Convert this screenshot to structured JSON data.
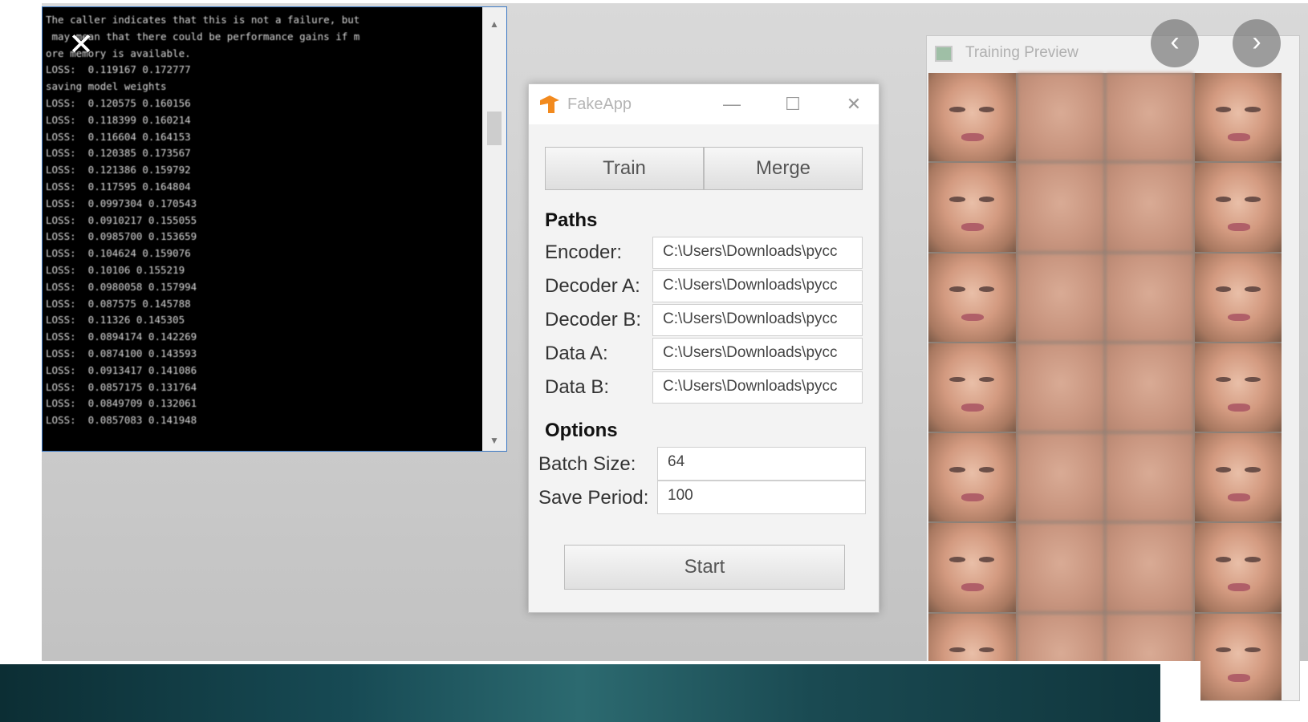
{
  "console": {
    "lines": [
      "The caller indicates that this is not a failure, but",
      " may mean that there could be performance gains if m",
      "ore memory is available.",
      "LOSS:  0.119167 0.172777",
      "saving model weights",
      "LOSS:  0.120575 0.160156",
      "LOSS:  0.118399 0.160214",
      "LOSS:  0.116604 0.164153",
      "LOSS:  0.120385 0.173567",
      "LOSS:  0.121386 0.159792",
      "LOSS:  0.117595 0.164804",
      "LOSS:  0.0997304 0.170543",
      "LOSS:  0.0910217 0.155055",
      "LOSS:  0.0985700 0.153659",
      "LOSS:  0.104624 0.159076",
      "LOSS:  0.10106 0.155219",
      "LOSS:  0.0980058 0.157994",
      "LOSS:  0.087575 0.145788",
      "LOSS:  0.11326 0.145305",
      "LOSS:  0.0894174 0.142269",
      "LOSS:  0.0874100 0.143593",
      "LOSS:  0.0913417 0.141086",
      "LOSS:  0.0857175 0.131764",
      "LOSS:  0.0849709 0.132061",
      "LOSS:  0.0857083 0.141948"
    ]
  },
  "app": {
    "title": "FakeApp",
    "tabs": [
      "Train",
      "Merge"
    ],
    "paths_heading": "Paths",
    "paths": [
      {
        "label": "Encoder:",
        "value": "C:\\Users\\Downloads\\pycc"
      },
      {
        "label": "Decoder A:",
        "value": "C:\\Users\\Downloads\\pycc"
      },
      {
        "label": "Decoder B:",
        "value": "C:\\Users\\Downloads\\pycc"
      },
      {
        "label": "Data A:",
        "value": "C:\\Users\\Downloads\\pycc"
      },
      {
        "label": "Data B:",
        "value": "C:\\Users\\Downloads\\pycc"
      }
    ],
    "options_heading": "Options",
    "options": [
      {
        "label": "Batch Size:",
        "value": "64"
      },
      {
        "label": "Save Period:",
        "value": "100"
      }
    ],
    "start_label": "Start"
  },
  "preview": {
    "title": "Training Preview"
  },
  "colors": {
    "console_bg": "#000000",
    "console_border": "#3b78c4",
    "logo_orange": "#f28a1e"
  }
}
